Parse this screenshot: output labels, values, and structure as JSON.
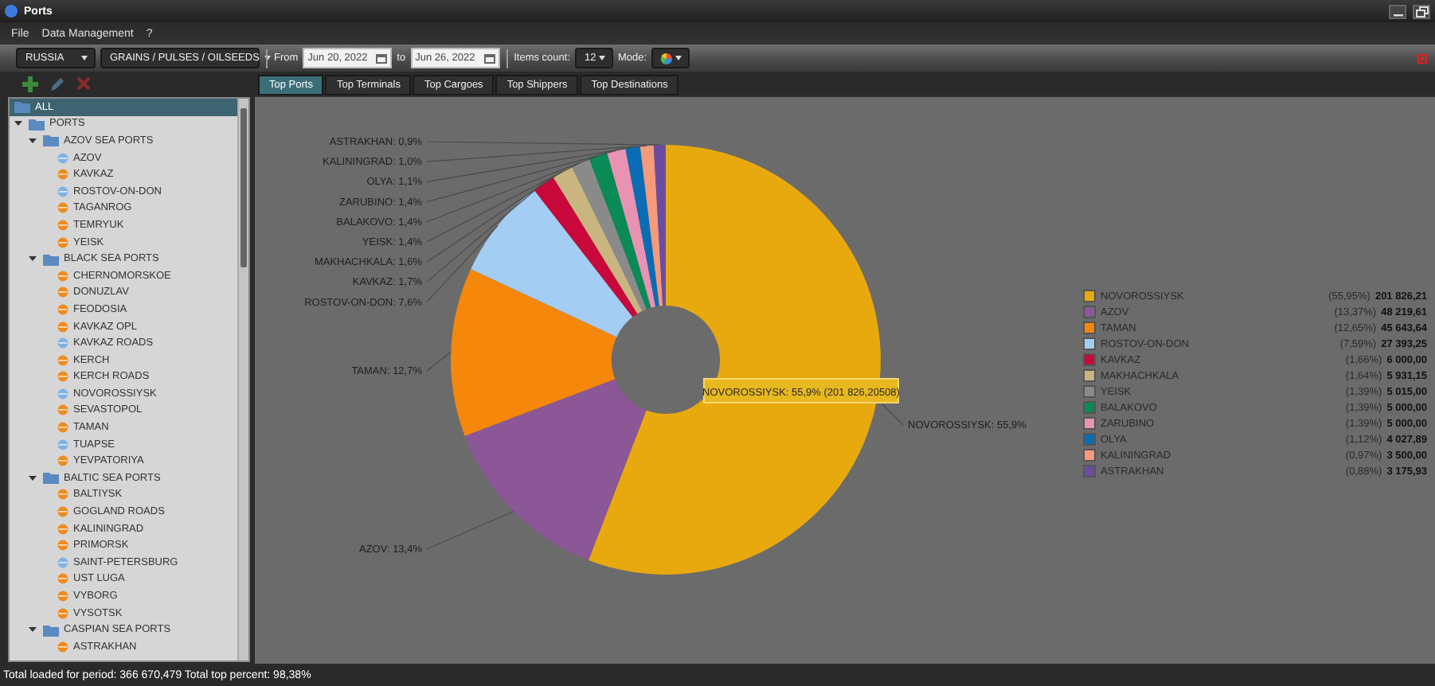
{
  "window": {
    "title": "Ports"
  },
  "menu": [
    "File",
    "Data Management",
    "?"
  ],
  "toolbar": {
    "country": "RUSSIA",
    "cargo": "GRAINS / PULSES / OILSEEDS",
    "from_label": "From",
    "from_date": "Jun 20, 2022",
    "to_label": "to",
    "to_date": "Jun 26, 2022",
    "items_count_label": "Items count:",
    "items_count": "12",
    "mode_label": "Mode:"
  },
  "tabs": [
    {
      "label": "Top Ports",
      "selected": true
    },
    {
      "label": "Top Terminals",
      "selected": false
    },
    {
      "label": "Top Cargoes",
      "selected": false
    },
    {
      "label": "Top Shippers",
      "selected": false
    },
    {
      "label": "Top Destinations",
      "selected": false
    }
  ],
  "tree": [
    {
      "label": "ALL",
      "kind": "root",
      "selected": true
    },
    {
      "label": "PORTS",
      "kind": "folder",
      "selected": false,
      "expanded": true,
      "children": [
        {
          "label": "AZOV SEA PORTS",
          "kind": "folder",
          "selected": false,
          "expanded": true,
          "children": [
            {
              "label": "AZOV",
              "kind": "port",
              "selected": false,
              "color": "#7fb2e8"
            },
            {
              "label": "KAVKAZ",
              "kind": "port",
              "selected": false,
              "color": "#f08a1c"
            },
            {
              "label": "ROSTOV-ON-DON",
              "kind": "port",
              "selected": false,
              "color": "#7fb2e8"
            },
            {
              "label": "TAGANROG",
              "kind": "port",
              "selected": false,
              "color": "#f08a1c"
            },
            {
              "label": "TEMRYUK",
              "kind": "port",
              "selected": false,
              "color": "#f08a1c"
            },
            {
              "label": "YEISK",
              "kind": "port",
              "selected": false,
              "color": "#f08a1c"
            }
          ]
        },
        {
          "label": "BLACK SEA PORTS",
          "kind": "folder",
          "selected": false,
          "expanded": true,
          "children": [
            {
              "label": "CHERNOMORSKOE",
              "kind": "port",
              "selected": false,
              "color": "#f08a1c"
            },
            {
              "label": "DONUZLAV",
              "kind": "port",
              "selected": false,
              "color": "#f08a1c"
            },
            {
              "label": "FEODOSIA",
              "kind": "port",
              "selected": false,
              "color": "#f08a1c"
            },
            {
              "label": "KAVKAZ OPL",
              "kind": "port",
              "selected": false,
              "color": "#f08a1c"
            },
            {
              "label": "KAVKAZ ROADS",
              "kind": "port",
              "selected": false,
              "color": "#7fb2e8"
            },
            {
              "label": "KERCH",
              "kind": "port",
              "selected": false,
              "color": "#f08a1c"
            },
            {
              "label": "KERCH ROADS",
              "kind": "port",
              "selected": false,
              "color": "#f08a1c"
            },
            {
              "label": "NOVOROSSIYSK",
              "kind": "port",
              "selected": false,
              "color": "#7fb2e8"
            },
            {
              "label": "SEVASTOPOL",
              "kind": "port",
              "selected": false,
              "color": "#f08a1c"
            },
            {
              "label": "TAMAN",
              "kind": "port",
              "selected": false,
              "color": "#f08a1c"
            },
            {
              "label": "TUAPSE",
              "kind": "port",
              "selected": false,
              "color": "#7fb2e8"
            },
            {
              "label": "YEVPATORIYA",
              "kind": "port",
              "selected": false,
              "color": "#f08a1c"
            }
          ]
        },
        {
          "label": "BALTIC SEA PORTS",
          "kind": "folder",
          "selected": false,
          "expanded": true,
          "children": [
            {
              "label": "BALTIYSK",
              "kind": "port",
              "selected": false,
              "color": "#f08a1c"
            },
            {
              "label": "GOGLAND ROADS",
              "kind": "port",
              "selected": false,
              "color": "#f08a1c"
            },
            {
              "label": "KALININGRAD",
              "kind": "port",
              "selected": false,
              "color": "#f08a1c"
            },
            {
              "label": "PRIMORSK",
              "kind": "port",
              "selected": false,
              "color": "#f08a1c"
            },
            {
              "label": "SAINT-PETERSBURG",
              "kind": "port",
              "selected": false,
              "color": "#7fb2e8"
            },
            {
              "label": "UST LUGA",
              "kind": "port",
              "selected": false,
              "color": "#f08a1c"
            },
            {
              "label": "VYBORG",
              "kind": "port",
              "selected": false,
              "color": "#f08a1c"
            },
            {
              "label": "VYSOTSK",
              "kind": "port",
              "selected": false,
              "color": "#f08a1c"
            }
          ]
        },
        {
          "label": "CASPIAN SEA PORTS",
          "kind": "folder",
          "selected": false,
          "expanded": true,
          "children": [
            {
              "label": "ASTRAKHAN",
              "kind": "port",
              "selected": false,
              "color": "#f08a1c"
            }
          ]
        }
      ]
    }
  ],
  "chart": {
    "chart_data": {
      "type": "donut",
      "categories": [
        "NOVOROSSIYSK",
        "AZOV",
        "TAMAN",
        "ROSTOV-ON-DON",
        "KAVKAZ",
        "MAKHACHKALA",
        "YEISK",
        "BALAKOVO",
        "ZARUBINO",
        "OLYA",
        "KALININGRAD",
        "ASTRAKHAN"
      ],
      "values": [
        55.9,
        13.4,
        12.7,
        7.6,
        1.7,
        1.6,
        1.4,
        1.4,
        1.4,
        1.1,
        1.0,
        0.9
      ],
      "value_labels": [
        "55,9%",
        "13,4%",
        "12,7%",
        "7,6%",
        "1,7%",
        "1,6%",
        "1,4%",
        "1,4%",
        "1,4%",
        "1,1%",
        "1,0%",
        "0,9%"
      ]
    },
    "label_separator": ": ",
    "tooltip": "NOVOROSSIYSK: 55,9% (201 826,20508)"
  },
  "legend": [
    {
      "label": "NOVOROSSIYSK",
      "color": "#e8a90e",
      "percent": "(55,95%)",
      "amount": "201 826,21"
    },
    {
      "label": "AZOV",
      "color": "#8b5796",
      "percent": "(13,37%)",
      "amount": "48 219,61"
    },
    {
      "label": "TAMAN",
      "color": "#f5870a",
      "percent": "(12,65%)",
      "amount": "45 643,64"
    },
    {
      "label": "ROSTOV-ON-DON",
      "color": "#a3cdf2",
      "percent": "(7,59%)",
      "amount": "27 393,25"
    },
    {
      "label": "KAVKAZ",
      "color": "#c8083a",
      "percent": "(1,66%)",
      "amount": "6 000,00"
    },
    {
      "label": "MAKHACHKALA",
      "color": "#c9b580",
      "percent": "(1,64%)",
      "amount": "5 931,15"
    },
    {
      "label": "YEISK",
      "color": "#8a8a8a",
      "percent": "(1,39%)",
      "amount": "5 015,00"
    },
    {
      "label": "BALAKOVO",
      "color": "#0a8a55",
      "percent": "(1,39%)",
      "amount": "5 000,00"
    },
    {
      "label": "ZARUBINO",
      "color": "#e892b4",
      "percent": "(1,39%)",
      "amount": "5 000,00"
    },
    {
      "label": "OLYA",
      "color": "#0a6cb4",
      "percent": "(1,12%)",
      "amount": "4 027,89"
    },
    {
      "label": "KALININGRAD",
      "color": "#f59a7a",
      "percent": "(0,97%)",
      "amount": "3 500,00"
    },
    {
      "label": "ASTRAKHAN",
      "color": "#6a4da0",
      "percent": "(0,88%)",
      "amount": "3 175,93"
    }
  ],
  "status_bar": "Total loaded for period: 366 670,479 Total top percent: 98,38%"
}
